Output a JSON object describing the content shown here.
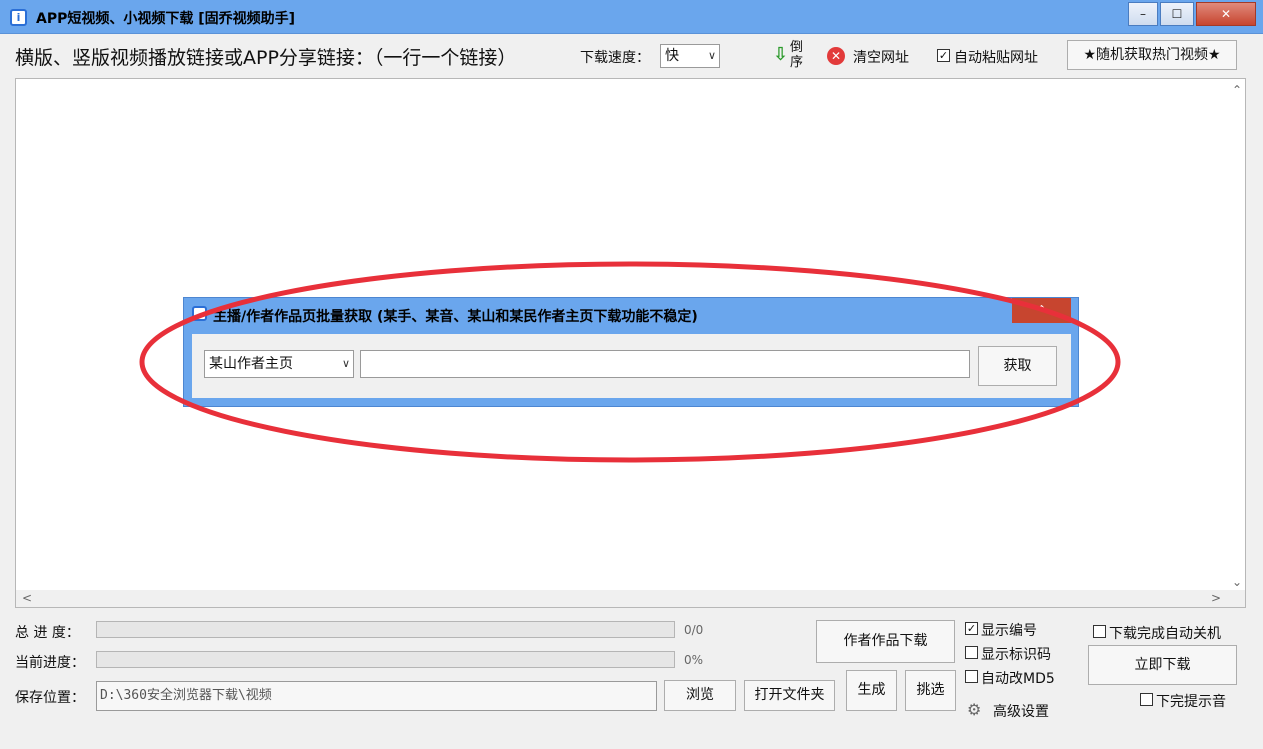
{
  "window": {
    "title": "APP短视频、小视频下载 [固乔视频助手]",
    "icon": "info-icon",
    "minimize": "–",
    "maximize": "☐",
    "close": "✕"
  },
  "toolbar": {
    "prompt": "横版、竖版视频播放链接或APP分享链接：（一行一个链接）",
    "speed_label": "下载速度：",
    "speed_value": "快",
    "reverse_label": "倒序",
    "clear_label": "清空网址",
    "auto_paste_label": "自动粘贴网址",
    "auto_paste_checked": true,
    "random_hot_label": "★随机获取热门视频★"
  },
  "main_area": {
    "content": ""
  },
  "dialog": {
    "title": "主播/作者作品页批量获取 (某手、某音、某山和某民作者主页下载功能不稳定)",
    "source_select": "某山作者主页",
    "url_value": "",
    "fetch_label": "获取",
    "close": "⌃"
  },
  "bottom": {
    "total_label": "总 进 度：",
    "total_value": "0/0",
    "total_fraction": 0,
    "current_label": "当前进度：",
    "current_value": "0%",
    "current_fraction": 0,
    "save_label": "保存位置：",
    "save_path": "D:\\360安全浏览器下载\\视频",
    "browse_label": "浏览",
    "open_folder_label": "打开文件夹",
    "author_download_label": "作者作品下载",
    "generate_label": "生成",
    "pick_label": "挑选",
    "show_number_label": "显示编号",
    "show_number_checked": true,
    "show_id_label": "显示标识码",
    "show_id_checked": false,
    "auto_md5_label": "自动改MD5",
    "auto_md5_checked": false,
    "advanced_label": "高级设置",
    "auto_shutdown_label": "下载完成自动关机",
    "auto_shutdown_checked": false,
    "download_now_label": "立即下载",
    "done_sound_label": "下完提示音",
    "done_sound_checked": false
  },
  "colors": {
    "titlebar": "#6aa6ed",
    "annotation_ellipse": "#e8303a",
    "close_button": "#c7452f"
  }
}
